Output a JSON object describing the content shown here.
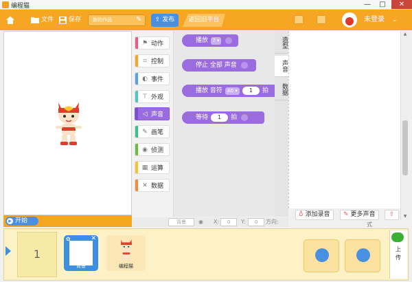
{
  "window": {
    "title": "编程猫",
    "min": "—",
    "max": "□",
    "close": "✕"
  },
  "toolbar": {
    "file_label": "文件",
    "save_label": "保存",
    "project_name": "新的作品",
    "publish_label": "发布",
    "back_label": "返回旧平台",
    "login_label": "未登录"
  },
  "stage": {
    "start_label": "开始"
  },
  "categories": [
    {
      "label": "动作",
      "icon": "run-icon",
      "color": "#e85a8f"
    },
    {
      "label": "控制",
      "icon": "gamepad-icon",
      "color": "#f6a623"
    },
    {
      "label": "事件",
      "icon": "toggle-icon",
      "color": "#5aa0e6"
    },
    {
      "label": "外观",
      "icon": "shirt-icon",
      "color": "#4fc4c4"
    },
    {
      "label": "声音",
      "icon": "speaker-icon",
      "color": "#9b6ce0",
      "active": true
    },
    {
      "label": "画笔",
      "icon": "pencil-icon",
      "color": "#3bc18d"
    },
    {
      "label": "侦测",
      "icon": "sensor-icon",
      "color": "#6bbb3f"
    },
    {
      "label": "运算",
      "icon": "calculator-icon",
      "color": "#f2c230"
    },
    {
      "label": "数据",
      "icon": "data-icon",
      "color": "#f28b3c"
    }
  ],
  "blocks": {
    "play": {
      "label": "播放",
      "dropdown": "?"
    },
    "stop_all": {
      "label": "停止 全部 声音"
    },
    "play_note": {
      "label": "播放 音符",
      "note": "A0",
      "beats": "1",
      "unit": "拍"
    },
    "rest": {
      "label": "等待",
      "beats": "1",
      "unit": "拍"
    }
  },
  "side_tabs": [
    {
      "label": "造型"
    },
    {
      "label": "声音",
      "active": true
    },
    {
      "label": "数据"
    }
  ],
  "sound_panel": {
    "add_record": "添加录音",
    "more_sounds": "更多声音"
  },
  "coord_bar": {
    "background_label": "背景",
    "x_label": "X:",
    "x_value": "0",
    "y_label": "Y:",
    "y_value": "0",
    "direction_label": "方向:"
  },
  "style_tag": "式",
  "bottom": {
    "scene_number": "1",
    "background_card_label": "背景",
    "sprite_card_label": "编程猫",
    "right_labels": [
      "上",
      "传"
    ]
  },
  "colors": {
    "toolbar": "#f6a623",
    "accent_blue": "#4a90e2",
    "sound_purple": "#9b6ce0"
  }
}
